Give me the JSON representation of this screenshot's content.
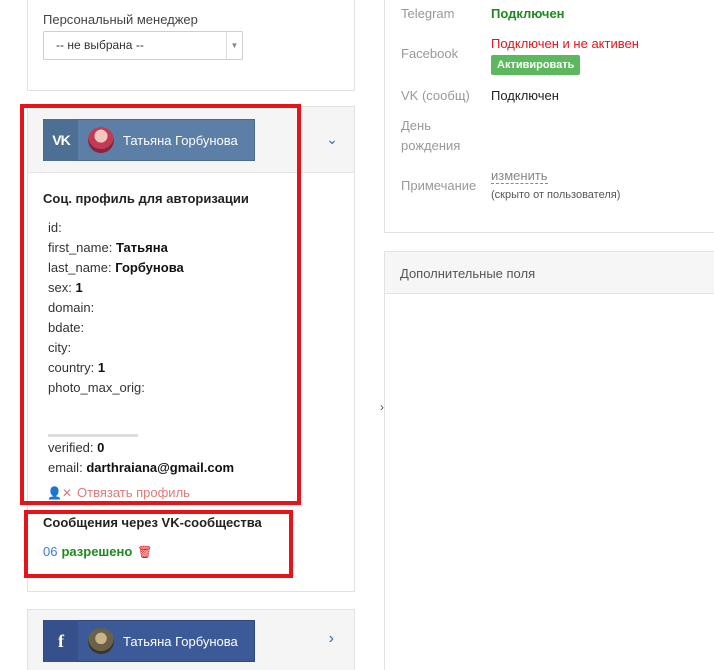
{
  "manager": {
    "label": "Персональный менеджер",
    "select_value": "-- не выбрана --"
  },
  "vk_account": {
    "network_icon": "vk-logo-icon",
    "name": "Татьяна Горбунова"
  },
  "profile": {
    "title": "Соц. профиль для авторизации",
    "fields": {
      "id_label": "id:",
      "first_name_label": "first_name:",
      "first_name_value": "Татьяна",
      "last_name_label": "last_name:",
      "last_name_value": "Горбунова",
      "sex_label": "sex:",
      "sex_value": "1",
      "domain_label": "domain:",
      "bdate_label": "bdate:",
      "city_label": "city:",
      "country_label": "country:",
      "country_value": "1",
      "photo_label": "photo_max_orig:",
      "verified_label": "verified:",
      "verified_value": "0",
      "email_label": "email:",
      "email_value": "darthraiana@gmail.com"
    },
    "unlink_label": "Отвязать профиль"
  },
  "messages": {
    "title": "Сообщения через VK-сообщества",
    "id_fragment": "06",
    "status": "разрешено"
  },
  "fb_account": {
    "network_icon": "facebook-logo-icon",
    "name": "Татьяна Горбунова"
  },
  "info": {
    "telegram_label": "Telegram",
    "telegram_value": "Подключен",
    "facebook_label": "Facebook",
    "facebook_value": "Подключен и не активен",
    "activate_label": "Активировать",
    "vk_label": "VK (сообщ)",
    "vk_value": "Подключен",
    "birthday_label_1": "День",
    "birthday_label_2": "рождения",
    "note_label": "Примечание",
    "note_change": "изменить",
    "note_hint": "(скрыто от пользователя)"
  },
  "extra": {
    "title": "Дополнительные поля"
  },
  "colors": {
    "connected_green": "#1e8a1e",
    "inactive_red": "#e4141a",
    "vk_blue": "#5b7fa6",
    "fb_blue": "#3d5a98",
    "annotation_red": "#e4141a"
  }
}
